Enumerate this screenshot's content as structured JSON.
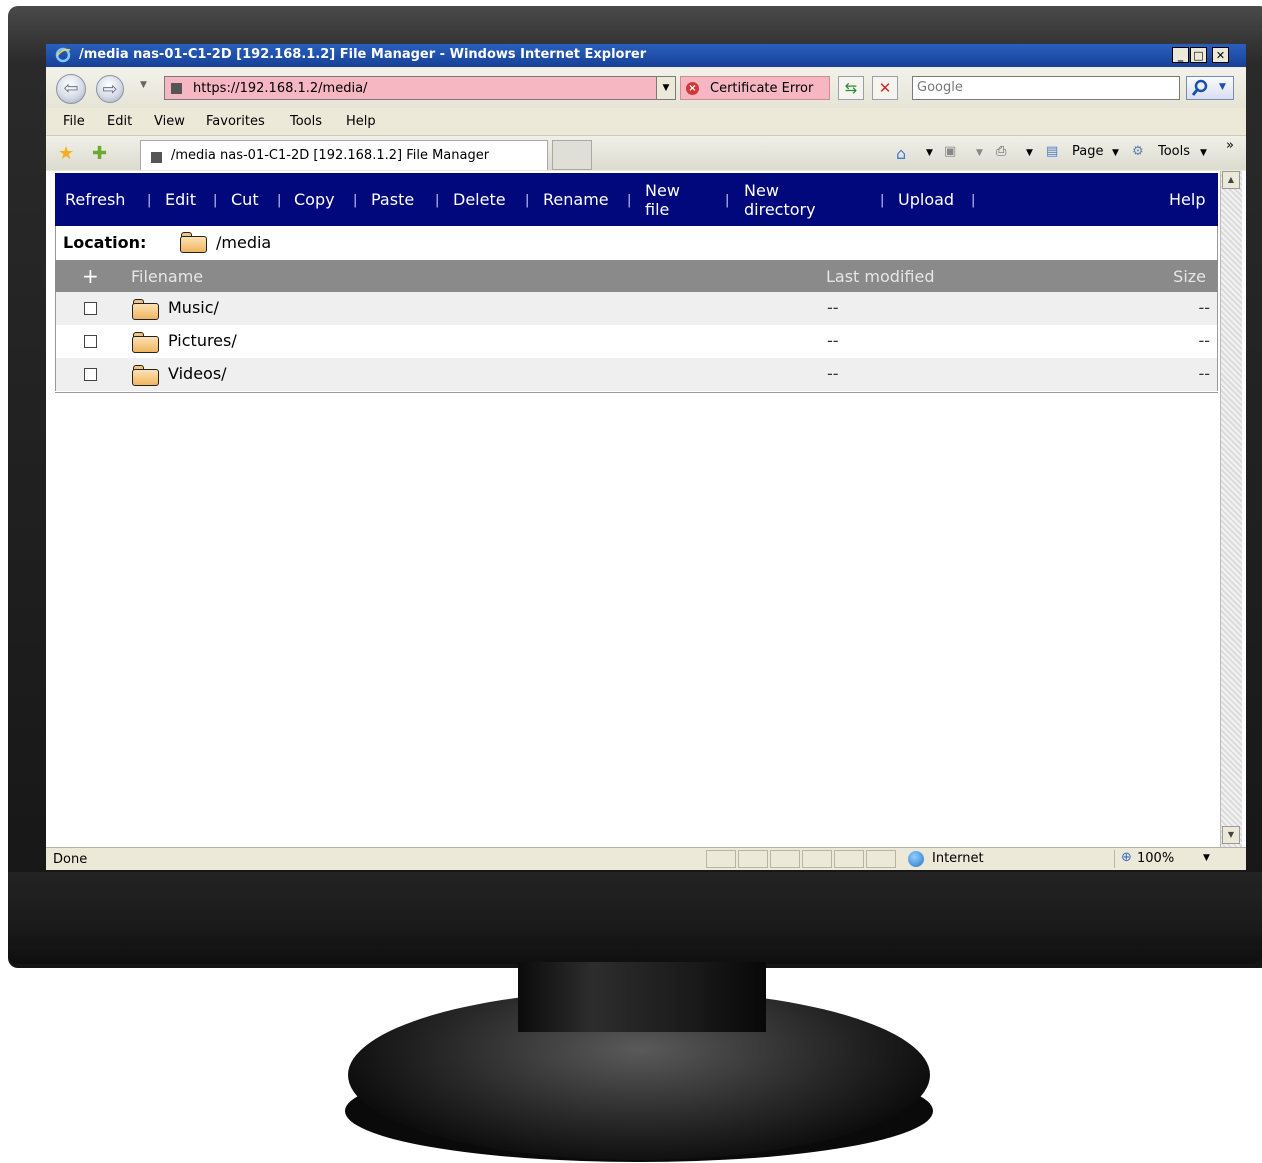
{
  "window": {
    "title": "/media nas-01-C1-2D [192.168.1.2] File Manager - Windows Internet Explorer",
    "minimize_icon": "minimize-icon",
    "maximize_icon": "maximize-icon",
    "close_icon": "close-icon"
  },
  "address": {
    "url": "https://192.168.1.2/media/",
    "certificate_error": "Certificate Error",
    "search_placeholder": "Google"
  },
  "menu": [
    "File",
    "Edit",
    "View",
    "Favorites",
    "Tools",
    "Help"
  ],
  "tab": {
    "label": "/media nas-01-C1-2D [192.168.1.2] File Manager"
  },
  "commandbar": {
    "page": "Page",
    "tools": "Tools",
    "more": "»"
  },
  "toolbar": {
    "refresh": "Refresh",
    "edit": "Edit",
    "cut": "Cut",
    "copy": "Copy",
    "paste": "Paste",
    "delete": "Delete",
    "rename": "Rename",
    "new_file_1": "New",
    "new_file_2": "file",
    "new_dir_1": "New",
    "new_dir_2": "directory",
    "upload": "Upload",
    "help": "Help",
    "separator": "|"
  },
  "location": {
    "label": "Location:",
    "path": "/media"
  },
  "list": {
    "header": {
      "toggle": "+",
      "filename": "Filename",
      "last_modified": "Last modified",
      "size": "Size"
    },
    "rows": [
      {
        "name": "Music/",
        "modified": "--",
        "size": "--"
      },
      {
        "name": "Pictures/",
        "modified": "--",
        "size": "--"
      },
      {
        "name": "Videos/",
        "modified": "--",
        "size": "--"
      }
    ]
  },
  "status": {
    "text": "Done",
    "zone": "Internet",
    "zoom": "100%"
  },
  "colors": {
    "toolbar_bg": "#00087c",
    "header_bg": "#8a8a8a",
    "cert_error_bg": "#f6b6c2",
    "titlebar": "#1f4fa8"
  }
}
